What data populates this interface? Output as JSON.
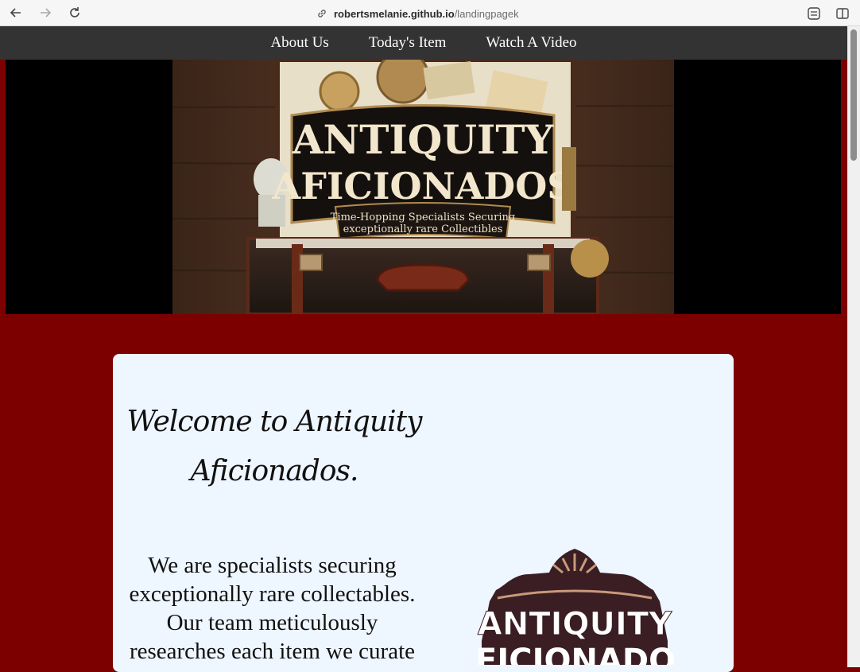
{
  "browser": {
    "url_domain": "robertsmelanie.github.io",
    "url_path": "/landingpagek"
  },
  "nav": {
    "items": [
      "About Us",
      "Today's Item",
      "Watch A Video"
    ]
  },
  "hero": {
    "title_line1": "ANTIQUITY",
    "title_line2": "AFICIONADOS",
    "tagline_line1": "Time-Hopping Specialists Securing",
    "tagline_line2": "exceptionally rare Collectibles"
  },
  "main": {
    "welcome": "Welcome to Antiquity Aficionados.",
    "description": "We are specialists securing exceptionally rare collectables. Our team meticulously researches each item we curate"
  },
  "badge": {
    "line1": "ANTIQUITY",
    "line2": "AFICIONADOS"
  },
  "colors": {
    "page_bg": "#7d0000",
    "nav_bg": "#333333",
    "card_bg": "#eef6ff"
  }
}
